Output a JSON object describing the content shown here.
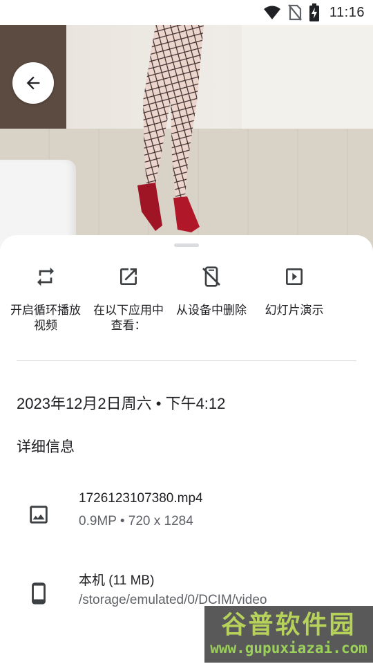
{
  "status_bar": {
    "time": "11:16",
    "icons": [
      "wifi-icon",
      "no-sim-icon",
      "battery-charging-icon"
    ]
  },
  "preview": {
    "description_icon": "photo-preview",
    "back_icon": "arrow-back-icon"
  },
  "actions": [
    {
      "icon": "repeat-icon",
      "label": "开启循环播放视频"
    },
    {
      "icon": "open-in-new-icon",
      "label": "在以下应用中查看："
    },
    {
      "icon": "phone-delete-icon",
      "label": "从设备中删除"
    },
    {
      "icon": "slideshow-icon",
      "label": "幻灯片演示"
    }
  ],
  "details": {
    "datetime": "2023年12月2日周六 • 下午4:12",
    "section_title": "详细信息",
    "file": {
      "icon": "image-icon",
      "name": "1726123107380.mp4",
      "meta": "0.9MP  •  720 x 1284"
    },
    "storage": {
      "icon": "phone-icon",
      "name": "本机 (11 MB)",
      "path": "/storage/emulated/0/DCIM/video"
    }
  },
  "watermark": {
    "title": "谷普软件园",
    "url": "www.gupuxiazai.com"
  }
}
